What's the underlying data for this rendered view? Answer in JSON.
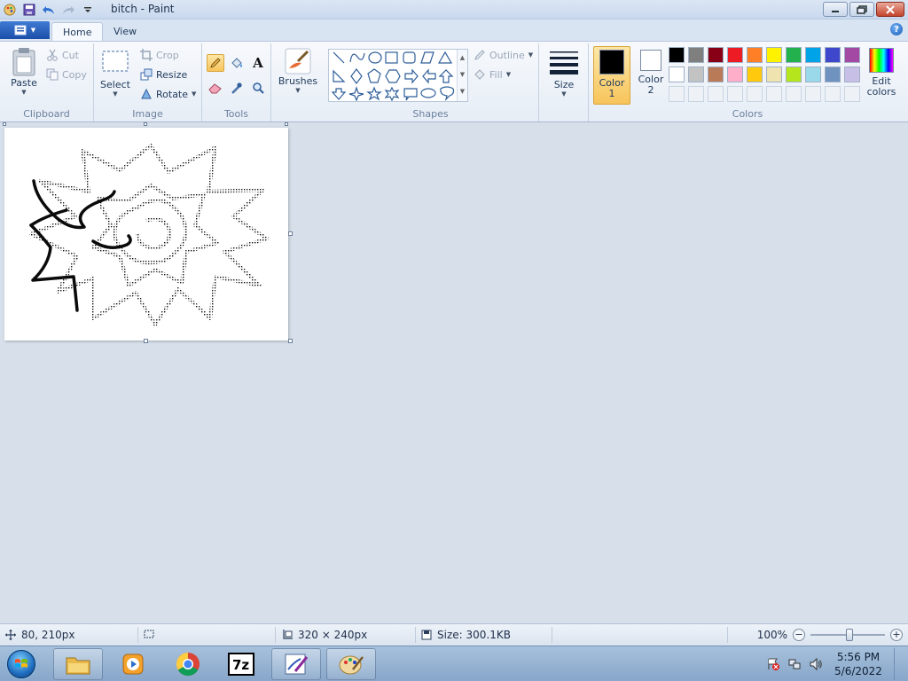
{
  "window": {
    "title": "bitch - Paint"
  },
  "tabs": {
    "home": "Home",
    "view": "View"
  },
  "ribbon": {
    "clipboard": {
      "label": "Clipboard",
      "paste": "Paste",
      "cut": "Cut",
      "copy": "Copy"
    },
    "image": {
      "label": "Image",
      "select": "Select",
      "crop": "Crop",
      "resize": "Resize",
      "rotate": "Rotate"
    },
    "tools": {
      "label": "Tools"
    },
    "brushes": {
      "label": "Brushes"
    },
    "shapes": {
      "label": "Shapes",
      "outline": "Outline",
      "fill": "Fill"
    },
    "size": {
      "label": "Size"
    },
    "colors": {
      "label": "Colors",
      "color1_l1": "Color",
      "color1_l2": "1",
      "color2_l1": "Color",
      "color2_l2": "2",
      "edit_l1": "Edit",
      "edit_l2": "colors",
      "color1_value": "#000000",
      "color2_value": "#ffffff",
      "palette_row1": [
        "#000000",
        "#7f7f7f",
        "#880015",
        "#ed1c24",
        "#ff7f27",
        "#fff200",
        "#22b14c",
        "#00a2e8",
        "#3f48cc",
        "#a349a4"
      ],
      "palette_row2": [
        "#ffffff",
        "#c3c3c3",
        "#b97a57",
        "#ffaec9",
        "#ffc90e",
        "#efe4b0",
        "#b5e61d",
        "#99d9ea",
        "#7092be",
        "#c8bfe7"
      ]
    }
  },
  "status": {
    "cursor_pos": "80, 210px",
    "canvas_size": "320 × 240px",
    "file_size": "Size: 300.1KB",
    "zoom": "100%"
  },
  "taskbar": {
    "time": "5:56 PM",
    "date": "5/6/2022",
    "apps": [
      "explorer-icon",
      "media-player-icon",
      "chrome-icon",
      "7zip-icon",
      "paint-pinned-icon",
      "paint-active-icon"
    ]
  }
}
